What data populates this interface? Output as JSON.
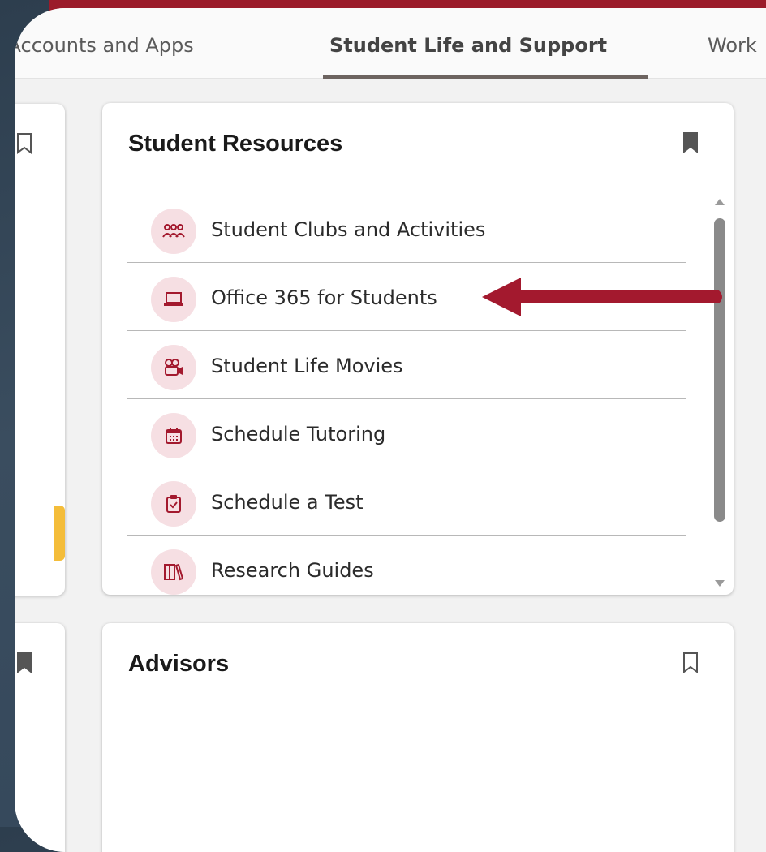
{
  "tabs": {
    "accounts": "r Accounts and Apps",
    "student_life": "Student Life and Support",
    "work": "Work"
  },
  "student_resources": {
    "title": "Student Resources",
    "items": [
      {
        "label": "Student Clubs and Activities",
        "icon": "users-group-icon"
      },
      {
        "label": "Office 365 for Students",
        "icon": "laptop-icon"
      },
      {
        "label": "Student Life Movies",
        "icon": "video-camera-icon"
      },
      {
        "label": "Schedule Tutoring",
        "icon": "calendar-icon"
      },
      {
        "label": "Schedule a Test",
        "icon": "clipboard-check-icon"
      },
      {
        "label": "Research Guides",
        "icon": "books-icon"
      }
    ]
  },
  "advisors": {
    "title": "Advisors"
  },
  "colors": {
    "accent": "#a3192e",
    "icon_bg": "#f6dfe3",
    "tab_underline": "#6d6460",
    "yellow": "#f4bd3a"
  }
}
